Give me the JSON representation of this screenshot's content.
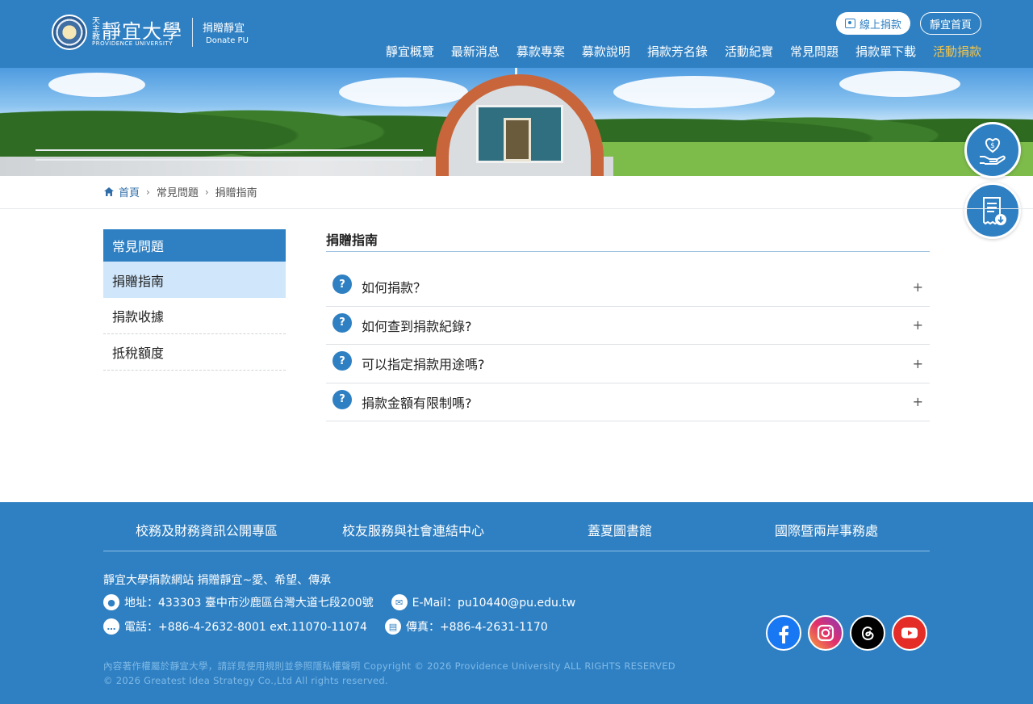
{
  "header": {
    "logo_small": "天主教",
    "logo_big": "靜宜大學",
    "logo_en": "PROVIDENCE UNIVERSITY",
    "site_cn": "捐贈靜宜",
    "site_en": "Donate PU",
    "online_donate": "線上捐款",
    "pu_home": "靜宜首頁",
    "nav": [
      "靜宜概覽",
      "最新消息",
      "募款專案",
      "募款說明",
      "捐款芳名錄",
      "活動紀實",
      "常見問題",
      "捐款單下載",
      "活動捐款"
    ],
    "active_color": "#f3c44a"
  },
  "breadcrumb": {
    "home": "首頁",
    "level1": "常見問題",
    "level2": "捐贈指南"
  },
  "sidebar": {
    "title": "常見問題",
    "items": [
      "捐贈指南",
      "捐款收據",
      "抵稅額度"
    ]
  },
  "main": {
    "title": "捐贈指南",
    "faqs": [
      "如何捐款？",
      "如何查到捐款紀錄?",
      "可以指定捐款用途嗎?",
      "捐款金額有限制嗎?"
    ]
  },
  "footer": {
    "links": [
      "校務及財務資訊公開專區",
      "校友服務與社會連結中心",
      "蓋夏圖書館",
      "國際暨兩岸事務處"
    ],
    "site_line": "靜宜大學捐款網站 捐贈靜宜~愛、希望、傳承",
    "address": "地址：433303 臺中市沙鹿區台灣大道七段200號",
    "email": "E-Mail：pu10440@pu.edu.tw",
    "phone": "電話：+886-4-2632-8001 ext.11070-11074",
    "fax": "傳真：+886-4-2631-1170",
    "copyright": "內容著作權屬於靜宜大學，請詳見使用規則並參照隱私權聲明 Copyright © 2026 Providence University ALL RIGHTS RESERVED © 2026 Greatest Idea Strategy Co.,Ltd All rights reserved."
  },
  "colors": {
    "brand_blue": "#2f80c3",
    "sidebar_active": "#cfe6fb"
  }
}
